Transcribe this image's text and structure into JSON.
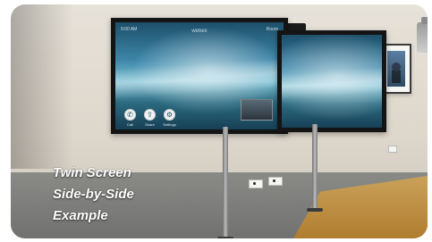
{
  "caption": {
    "line1": "Twin Screen",
    "line2": "Side-by-Side",
    "line3": "Example"
  },
  "left_display": {
    "brand": "webex",
    "topbar_left": "9:00 AM",
    "topbar_right": "Room",
    "controls": [
      {
        "icon": "phone-icon",
        "glyph": "✆",
        "label": "Call"
      },
      {
        "icon": "share-icon",
        "glyph": "⇪",
        "label": "Share"
      },
      {
        "icon": "settings-icon",
        "glyph": "⚙",
        "label": "Settings"
      }
    ]
  },
  "right_display": {
    "topbar_left": "",
    "topbar_right": ""
  },
  "colors": {
    "wall": "#e7e2d9",
    "screen_sky": "#3d86a8",
    "caption_text": "#ffffff"
  }
}
